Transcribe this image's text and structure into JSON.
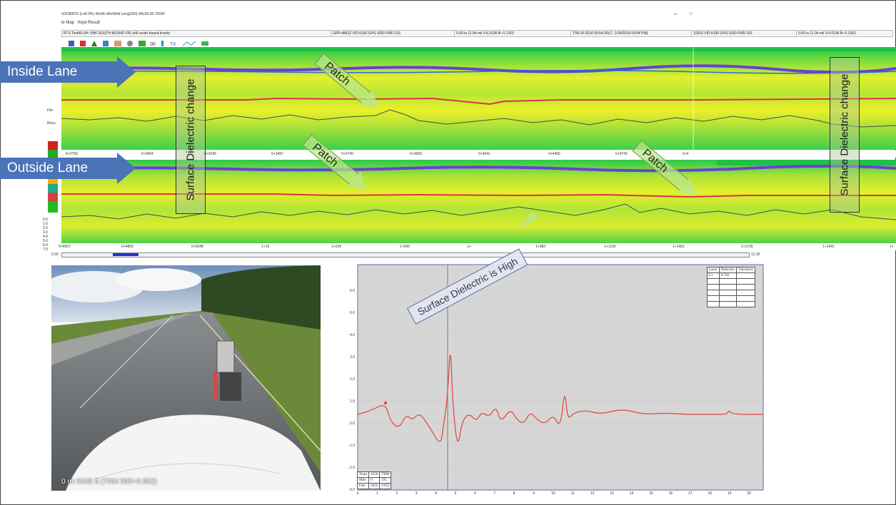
{
  "window": {
    "title_line": "SOOBRTS (Left 0%) 40nRt nRnRWd Long(330) 9Rz25.00.7OOR",
    "menu": [
      "le Map",
      "Kept Result"
    ],
    "status": {
      "file": "RTS Test/t0-SH: SH6 SOUTH BOUND FR( sh6 south bound frontal",
      "gpr1": "GPR:48622 VID:5190 GPS:1050 FWD:101",
      "pos1": "0.00 ts  11.94 mil  V:6.0196  B:-0.1263",
      "date": "T08-18-2018 09:54:30]  C: 1/30/2018 09:54 PM]",
      "gpr2": "10203 VID:5190 GPS:1050 FWD:101",
      "pos2": "0.00 ts  11.94 mil  V:6.0196  B:-0.1263"
    },
    "side_menu": [
      "File",
      "Resu"
    ]
  },
  "annotations": {
    "inside_lane": "Inside Lane",
    "outside_lane": "Outside Lane",
    "patch": "Patch",
    "surface_change": "Surface Dielectric change",
    "surface_high": "Surface Dielectric is High"
  },
  "ruler_top": [
    "0+2759",
    "0+3004",
    "0+3246",
    "0+3497",
    "0+3749",
    "0+3993",
    "0+4241",
    "0+4492",
    "0+4742",
    "0+4"
  ],
  "ruler_bottom": [
    "0+4507",
    "0+4805",
    "0+5048",
    "1+10",
    "1+239",
    "1+506",
    "1+",
    "1+983",
    "1+1226",
    "1+1461",
    "1+1705",
    "1+1941",
    "1+"
  ],
  "depth_ticks": [
    "0.0",
    "1.0",
    "2.0",
    "3.0",
    "4.0",
    "5.0",
    "6.0",
    "7.0"
  ],
  "scroll": {
    "left": "0.00",
    "right": "12.26"
  },
  "video": {
    "caption": "0 mi  5035 ft    (TRM 595+0.952)"
  },
  "waveform": {
    "y_ticks": [
      "6.0",
      "5.0",
      "4.0",
      "3.0",
      "2.0",
      "1.0",
      "0.0",
      "-1.0",
      "-2.0",
      "-3.0"
    ],
    "x_ticks": [
      "0",
      "1",
      "2",
      "3",
      "4",
      "5",
      "6",
      "7",
      "8",
      "9",
      "10",
      "11",
      "12",
      "13",
      "14",
      "15",
      "16",
      "17",
      "18",
      "19",
      "20"
    ],
    "layer_table": {
      "headers": [
        "Layer",
        "Dielectric",
        "Thickness"
      ],
      "row": [
        "L1",
        "9.758",
        ""
      ]
    },
    "info_table": [
      [
        "Trace",
        "4336",
        "TRM"
      ],
      [
        "Mile",
        "0",
        "595"
      ],
      [
        "Feet",
        "5035",
        "0.952"
      ]
    ],
    "colors": {
      "trace": "#e0453a",
      "bg": "#d6d6d6"
    }
  }
}
